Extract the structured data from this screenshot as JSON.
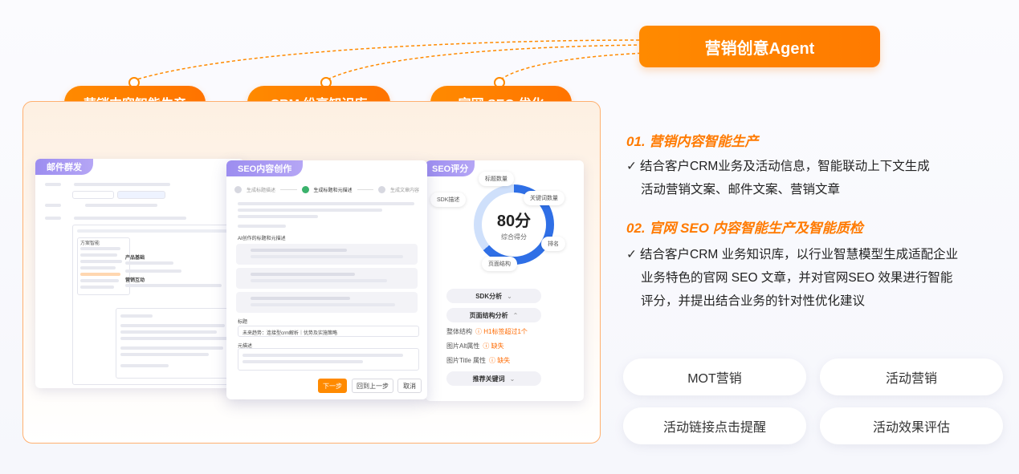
{
  "agent_label": "营销创意Agent",
  "pills": [
    "营销内容智能生产",
    "CRM 纷享知识库",
    "官网 SEO 优化"
  ],
  "colors": {
    "accent": "#ff8a00",
    "window_tab": "#9c8df0",
    "gauge": "#2f6fe6"
  },
  "mail_window": {
    "tab": "邮件群发",
    "sidebar_heading": "方案智能",
    "detail_heading_1": "产品基础",
    "detail_heading_2": "营销互动"
  },
  "seo_window": {
    "tab": "SEO内容创作",
    "steps": [
      "生成标题描述",
      "生成标题和元描述",
      "生成文章内容"
    ],
    "section_label": "AI创作的标题和元描述",
    "title_label": "标题",
    "title_value": "未来趋势：连接型crm解析｜优势及实施策略",
    "desc_label": "元描述",
    "buttons": {
      "next": "下一步",
      "back": "回到上一步",
      "cancel": "取消"
    }
  },
  "seo_score_window": {
    "tab": "SEO评分",
    "score": "80分",
    "score_label": "综合得分",
    "chips": [
      "标题数量",
      "关键词数量",
      "排名",
      "页面结构",
      "SDK描述"
    ],
    "rows": {
      "sdk": "SDK分析",
      "page": "页面结构分析",
      "keywords": "推荐关键词"
    },
    "checks": [
      {
        "label": "整体结构",
        "status": "H1标签超过1个"
      },
      {
        "label": "图片Alt属性",
        "status": "缺失"
      },
      {
        "label": "图片Title 属性",
        "status": "缺失"
      }
    ]
  },
  "sections": [
    {
      "num": "01.",
      "title": "营销内容智能生产",
      "text_lines": [
        "结合客户CRM业务及活动信息，智能联动上下文生成",
        "活动营销文案、邮件文案、营销文章"
      ]
    },
    {
      "num": "02.",
      "title": "官网 SEO 内容智能生产及智能质检",
      "text_lines": [
        "结合客户CRM 业务知识库，以行业智慧模型生成适配企业",
        "业务特色的官网 SEO 文章，并对官网SEO 效果进行智能",
        "评分，并提出结合业务的针对性优化建议"
      ]
    }
  ],
  "check_mark": "✓",
  "tags": [
    "MOT营销",
    "活动营销",
    "活动链接点击提醒",
    "活动效果评估"
  ]
}
